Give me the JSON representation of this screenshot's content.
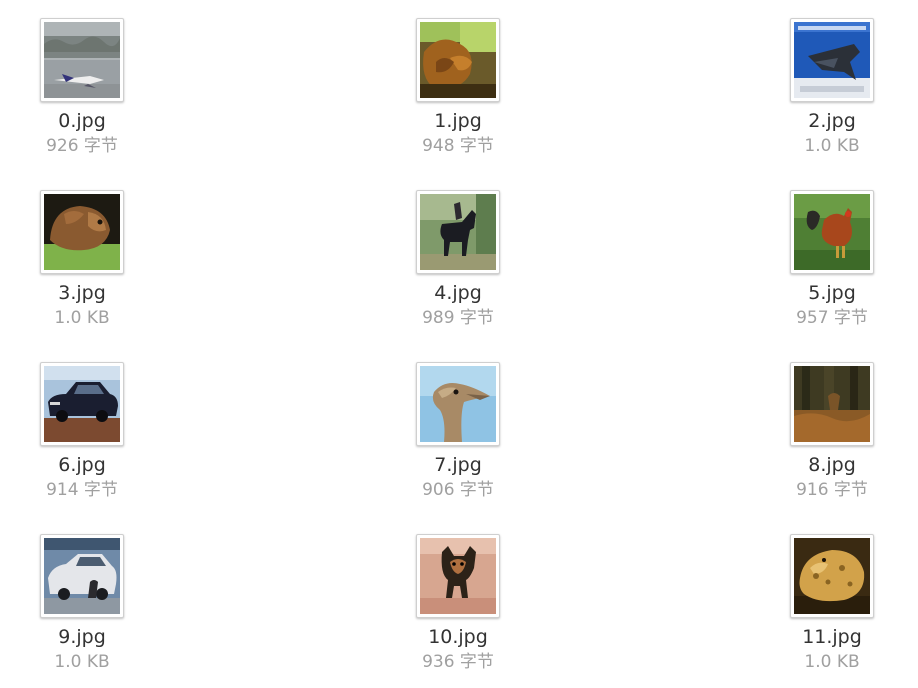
{
  "files": [
    {
      "name": "0.jpg",
      "size": "926 字节",
      "icon": "airplane-thumbnail-icon"
    },
    {
      "name": "1.jpg",
      "size": "948 字节",
      "icon": "deer-thumbnail-icon"
    },
    {
      "name": "2.jpg",
      "size": "1.0 KB",
      "icon": "airplane-thumbnail-icon"
    },
    {
      "name": "3.jpg",
      "size": "1.0 KB",
      "icon": "animal-thumbnail-icon"
    },
    {
      "name": "4.jpg",
      "size": "989 字节",
      "icon": "horse-thumbnail-icon"
    },
    {
      "name": "5.jpg",
      "size": "957 字节",
      "icon": "bird-thumbnail-icon"
    },
    {
      "name": "6.jpg",
      "size": "914 字节",
      "icon": "car-thumbnail-icon"
    },
    {
      "name": "7.jpg",
      "size": "906 字节",
      "icon": "ostrich-thumbnail-icon"
    },
    {
      "name": "8.jpg",
      "size": "916 字节",
      "icon": "deer-thumbnail-icon"
    },
    {
      "name": "9.jpg",
      "size": "1.0 KB",
      "icon": "car-thumbnail-icon"
    },
    {
      "name": "10.jpg",
      "size": "936 字节",
      "icon": "dog-thumbnail-icon"
    },
    {
      "name": "11.jpg",
      "size": "1.0 KB",
      "icon": "frog-thumbnail-icon"
    }
  ],
  "colors": {
    "filename_text": "#333333",
    "size_text": "#a0a0a0",
    "thumb_border": "#cfcfcf"
  }
}
